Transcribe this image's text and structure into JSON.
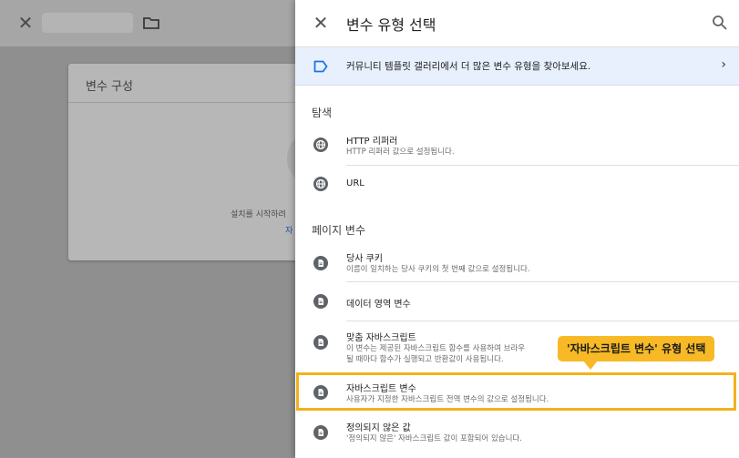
{
  "background": {
    "card_title": "변수 구성",
    "card_hint": "설치를 시작하려",
    "card_link": "자"
  },
  "panel": {
    "title": "변수 유형 선택",
    "banner_text": "커뮤니티 템플릿 갤러리에서 더 많은 변수 유형을 찾아보세요.",
    "banner_chevron": "›",
    "sections": {
      "explore": "탐색",
      "page_variables": "페이지 변수"
    },
    "items": [
      {
        "title": "HTTP 리퍼러",
        "desc": "HTTP 리퍼러 값으로 설정됩니다.",
        "icon": "globe-icon"
      },
      {
        "title": "URL",
        "desc": "",
        "icon": "globe-icon"
      },
      {
        "title": "당사 쿠키",
        "desc": "이름이 일치하는 당사 쿠키의 첫 번째 값으로 설정됩니다.",
        "icon": "document-icon"
      },
      {
        "title": "데이터 영역 변수",
        "desc": "",
        "icon": "document-icon"
      },
      {
        "title": "맞춤 자바스크립트",
        "desc": "이 변수는 제공된 자바스크립트 함수를 사용하여 브라우",
        "desc2": "될 때마다 함수가 실행되고 반환값이 사용됩니다.",
        "icon": "document-icon"
      },
      {
        "title": "자바스크립트 변수",
        "desc": "사용자가 지정한 자바스크립트 전역 변수의 값으로 설정됩니다.",
        "icon": "document-icon"
      },
      {
        "title": "정의되지 않은 값",
        "desc": "'정의되지 않은' 자바스크립트 값이 포함되어 있습니다.",
        "icon": "document-icon"
      }
    ]
  },
  "callout": {
    "text": "'자바스크립트 변수' 유형 선택"
  },
  "colors": {
    "accent": "#1a73e8",
    "highlight": "#f2b21d",
    "callout_bg": "#f7b925"
  }
}
